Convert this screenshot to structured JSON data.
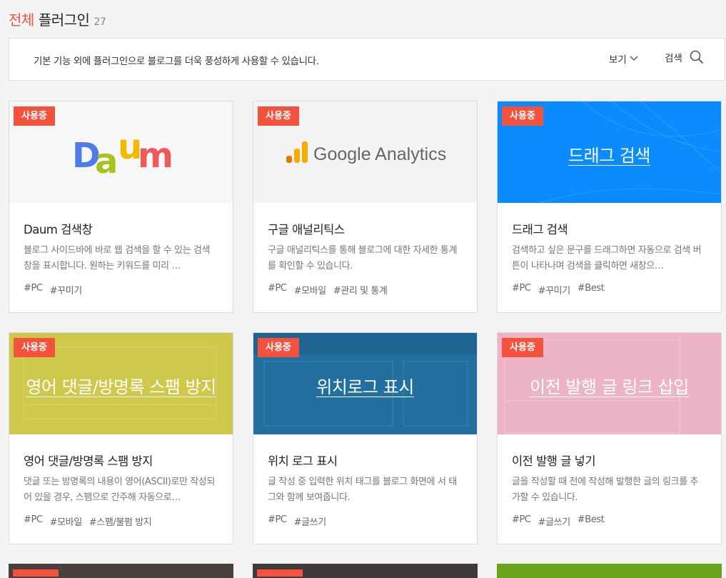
{
  "header": {
    "category": "전체",
    "title": "플러그인",
    "count": "27"
  },
  "bar": {
    "description": "기본 기능 외에 플러그인으로 블로그를 더욱 풍성하게 사용할 수 있습니다.",
    "view_label": "보기",
    "search_label": "검색"
  },
  "cards": [
    {
      "badge": "사용중",
      "thumb_brand": "Daum",
      "name": "Daum 검색창",
      "summary": "블로그 사이드바에 바로 웹 검색을 할 수 있는 검색창을 표시합니다. 원하는 키워드를 미리 …",
      "tags": [
        "#PC",
        "#꾸미기"
      ]
    },
    {
      "badge": "사용중",
      "thumb_brand": "Google Analytics",
      "name": "구글 애널리틱스",
      "summary": "구글 애널리틱스를 통해 블로그에 대한 자세한 통계를 확인할 수 있습니다.",
      "tags": [
        "#PC",
        "#모바일",
        "#관리 및 통계"
      ]
    },
    {
      "badge": "사용중",
      "thumb_text": "드래그 검색",
      "name": "드래그 검색",
      "summary": "검색하고 싶은 문구를 드래그하면 자동으로 검색 버튼이 나타나며 검색을 클릭하면 새창으…",
      "tags": [
        "#PC",
        "#꾸미기",
        "#Best"
      ]
    },
    {
      "badge": "사용중",
      "thumb_text": "영어 댓글/방명록 스팸 방지",
      "name": "영어 댓글/방명록 스팸 방지",
      "summary": "댓글 또는 방명록의 내용이 영어(ASCII)로만 작성되어 있을 경우, 스팸으로 간주해 자동으로…",
      "tags": [
        "#PC",
        "#모바일",
        "#스팸/불펌 방지"
      ]
    },
    {
      "badge": "사용중",
      "thumb_text": "위치로그 표시",
      "name": "위치 로그 표시",
      "summary": "글 작성 중 입력한 위치 태그를 블로그 화면에 서 태그와 함께 보여줍니다.",
      "tags": [
        "#PC",
        "#글쓰기"
      ]
    },
    {
      "badge": "사용중",
      "thumb_text": "이전 발행 글 링크 삽입",
      "name": "이전 발행 글 넣기",
      "summary": "글을 작성할 때 전에 작성해 발행한 글의 링크를 추가할 수 있습니다.",
      "tags": [
        "#PC",
        "#글쓰기",
        "#Best"
      ]
    }
  ],
  "colors": {
    "accent": "#f5523e",
    "daum_blue": "#4f7be8",
    "daum_yellow": "#f5b800",
    "daum_green": "#a7c41d",
    "daum_red": "#f05a5a",
    "ga_orange": "#f9ab00",
    "drag_blue": "#0a8cff",
    "spam_olive": "#cec94b",
    "location_blue": "#21709f",
    "link_pink": "#edb4c8"
  }
}
